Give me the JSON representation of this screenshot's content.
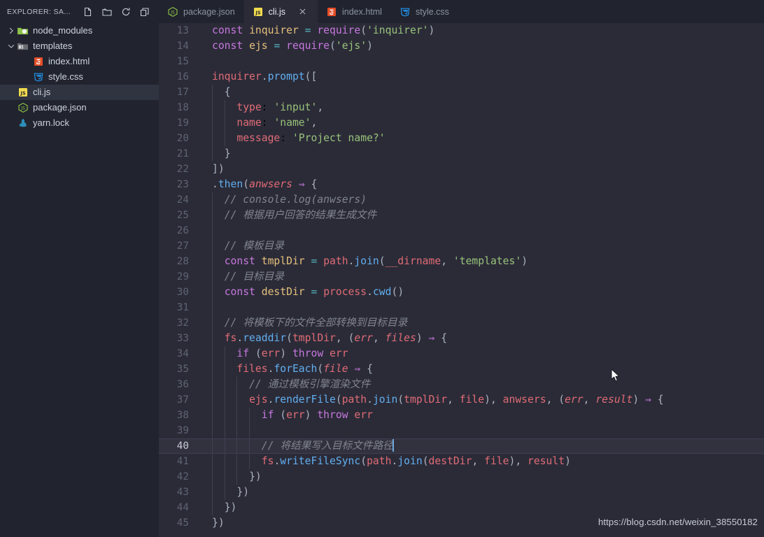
{
  "sidebar": {
    "title": "EXPLORER: SA...",
    "actions": [
      {
        "name": "new-file-icon",
        "label": "New File"
      },
      {
        "name": "new-folder-icon",
        "label": "New Folder"
      },
      {
        "name": "refresh-icon",
        "label": "Refresh Explorer"
      },
      {
        "name": "collapse-all-icon",
        "label": "Collapse Folders in Explorer"
      }
    ],
    "tree": [
      {
        "label": "node_modules",
        "kind": "folder",
        "icon": "folder-node-modules-icon",
        "expanded": false,
        "depth": 1,
        "selected": false
      },
      {
        "label": "templates",
        "kind": "folder",
        "icon": "folder-templates-icon",
        "expanded": true,
        "depth": 1,
        "selected": false
      },
      {
        "label": "index.html",
        "kind": "file",
        "icon": "html-icon",
        "depth": 2,
        "selected": false
      },
      {
        "label": "style.css",
        "kind": "file",
        "icon": "css-icon",
        "depth": 2,
        "selected": false
      },
      {
        "label": "cli.js",
        "kind": "file",
        "icon": "js-icon",
        "depth": 1,
        "selected": true
      },
      {
        "label": "package.json",
        "kind": "file",
        "icon": "nodejs-icon",
        "depth": 1,
        "selected": false
      },
      {
        "label": "yarn.lock",
        "kind": "file",
        "icon": "yarn-icon",
        "depth": 1,
        "selected": false
      }
    ]
  },
  "tabs": [
    {
      "label": "package.json",
      "icon": "nodejs-icon",
      "active": false,
      "closable": false
    },
    {
      "label": "cli.js",
      "icon": "js-icon",
      "active": true,
      "closable": true
    },
    {
      "label": "index.html",
      "icon": "html-icon",
      "active": false,
      "closable": false
    },
    {
      "label": "style.css",
      "icon": "css-icon",
      "active": false,
      "closable": false
    }
  ],
  "editor": {
    "first_line": 13,
    "active_line": 40,
    "cursor_line": 40,
    "language": "javascript",
    "lines": [
      {
        "n": 13,
        "text": "const inquirer = require('inquirer')"
      },
      {
        "n": 14,
        "text": "const ejs = require('ejs')"
      },
      {
        "n": 15,
        "text": ""
      },
      {
        "n": 16,
        "text": "inquirer.prompt(["
      },
      {
        "n": 17,
        "text": "  {"
      },
      {
        "n": 18,
        "text": "    type: 'input',"
      },
      {
        "n": 19,
        "text": "    name: 'name',"
      },
      {
        "n": 20,
        "text": "    message: 'Project name?'"
      },
      {
        "n": 21,
        "text": "  }"
      },
      {
        "n": 22,
        "text": "])"
      },
      {
        "n": 23,
        "text": ".then(anwsers ⇒ {"
      },
      {
        "n": 24,
        "text": "  // console.log(anwsers)"
      },
      {
        "n": 25,
        "text": "  // 根据用户回答的结果生成文件"
      },
      {
        "n": 26,
        "text": ""
      },
      {
        "n": 27,
        "text": "  // 模板目录"
      },
      {
        "n": 28,
        "text": "  const tmplDir = path.join(__dirname, 'templates')"
      },
      {
        "n": 29,
        "text": "  // 目标目录"
      },
      {
        "n": 30,
        "text": "  const destDir = process.cwd()"
      },
      {
        "n": 31,
        "text": ""
      },
      {
        "n": 32,
        "text": "  // 将模板下的文件全部转换到目标目录"
      },
      {
        "n": 33,
        "text": "  fs.readdir(tmplDir, (err, files) ⇒ {"
      },
      {
        "n": 34,
        "text": "    if (err) throw err"
      },
      {
        "n": 35,
        "text": "    files.forEach(file ⇒ {"
      },
      {
        "n": 36,
        "text": "      // 通过模板引擎渲染文件"
      },
      {
        "n": 37,
        "text": "      ejs.renderFile(path.join(tmplDir, file), anwsers, (err, result) ⇒ {"
      },
      {
        "n": 38,
        "text": "        if (err) throw err"
      },
      {
        "n": 39,
        "text": ""
      },
      {
        "n": 40,
        "text": "        // 将结果写入目标文件路径"
      },
      {
        "n": 41,
        "text": "        fs.writeFileSync(path.join(destDir, file), result)"
      },
      {
        "n": 42,
        "text": "      })"
      },
      {
        "n": 43,
        "text": "    })"
      },
      {
        "n": 44,
        "text": "  })"
      },
      {
        "n": 45,
        "text": "})"
      }
    ]
  },
  "watermark": "https://blog.csdn.net/weixin_38550182",
  "colors": {
    "sidebar_bg": "#21242e",
    "editor_bg": "#2b2b38",
    "active_line_bg": "#32323f",
    "selection_bg": "#2f3440",
    "keyword": "#c678dd",
    "variable": "#e5c07b",
    "function": "#61afef",
    "string": "#98c379",
    "comment": "#7f848e",
    "operator": "#56b6c2",
    "object": "#e06c75",
    "line_number": "#5e6472",
    "caret": "#6fa8dc"
  }
}
